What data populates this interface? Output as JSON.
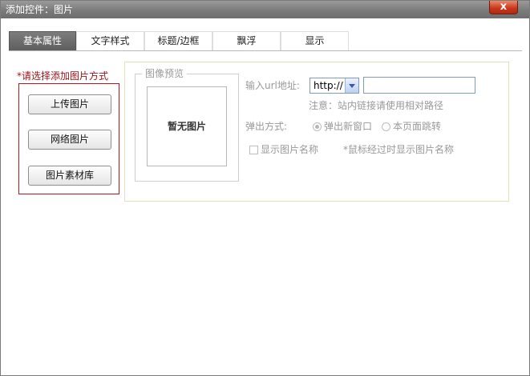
{
  "window": {
    "title": "添加控件：图片",
    "close_glyph": "x"
  },
  "tabs": [
    {
      "label": "基本属性",
      "active": true
    },
    {
      "label": "文字样式",
      "active": false
    },
    {
      "label": "标题/边框",
      "active": false
    },
    {
      "label": "飘浮",
      "active": false
    },
    {
      "label": "显示",
      "active": false
    }
  ],
  "add_method": {
    "label": "*请选择添加图片方式",
    "buttons": [
      "上传图片",
      "网络图片",
      "图片素材库"
    ]
  },
  "preview": {
    "legend": "图像预览",
    "empty_text": "暂无图片"
  },
  "url": {
    "label": "输入url地址:",
    "protocol": "http://",
    "value": "",
    "note": "注意：站内链接请使用相对路径"
  },
  "popup": {
    "label": "弹出方式:",
    "options": [
      {
        "label": "弹出新窗口",
        "checked": true
      },
      {
        "label": "本页面跳转",
        "checked": false
      }
    ]
  },
  "show_name": {
    "label": "显示图片名称",
    "checked": false,
    "hint": "*鼠标经过时显示图片名称"
  },
  "colors": {
    "titlebar": "#7b7b7b",
    "close": "#c8351a",
    "method_border": "#c6121c",
    "panel_border": "#e2e1bb"
  }
}
